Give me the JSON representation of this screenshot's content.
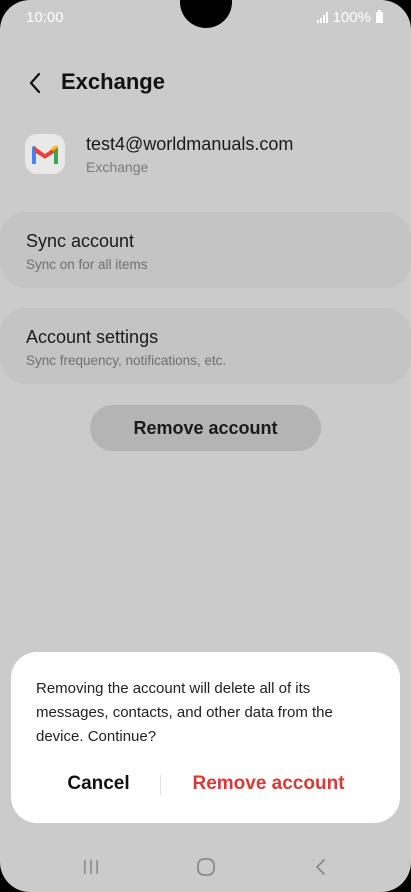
{
  "status_bar": {
    "time": "10:00",
    "battery": "100%"
  },
  "header": {
    "title": "Exchange"
  },
  "account": {
    "email": "test4@worldmanuals.com",
    "type": "Exchange"
  },
  "sync": {
    "title": "Sync account",
    "subtitle": "Sync on for all items"
  },
  "settings": {
    "title": "Account settings",
    "subtitle": "Sync frequency, notifications, etc."
  },
  "remove_button": {
    "label": "Remove account"
  },
  "dialog": {
    "message": "Removing the account will delete all of its messages, contacts, and other data from the device. Continue?",
    "cancel_label": "Cancel",
    "confirm_label": "Remove account"
  },
  "colors": {
    "confirm_red": "#d63b36",
    "gmail_blue": "#4285F4",
    "gmail_red": "#EA4335",
    "gmail_yellow": "#FBBC04",
    "gmail_green": "#34A853"
  },
  "icons": {
    "back": "chevron-left-icon",
    "account": "gmail-icon",
    "nav_recent": "recent-apps-icon",
    "nav_home": "home-icon",
    "nav_back": "back-icon"
  }
}
